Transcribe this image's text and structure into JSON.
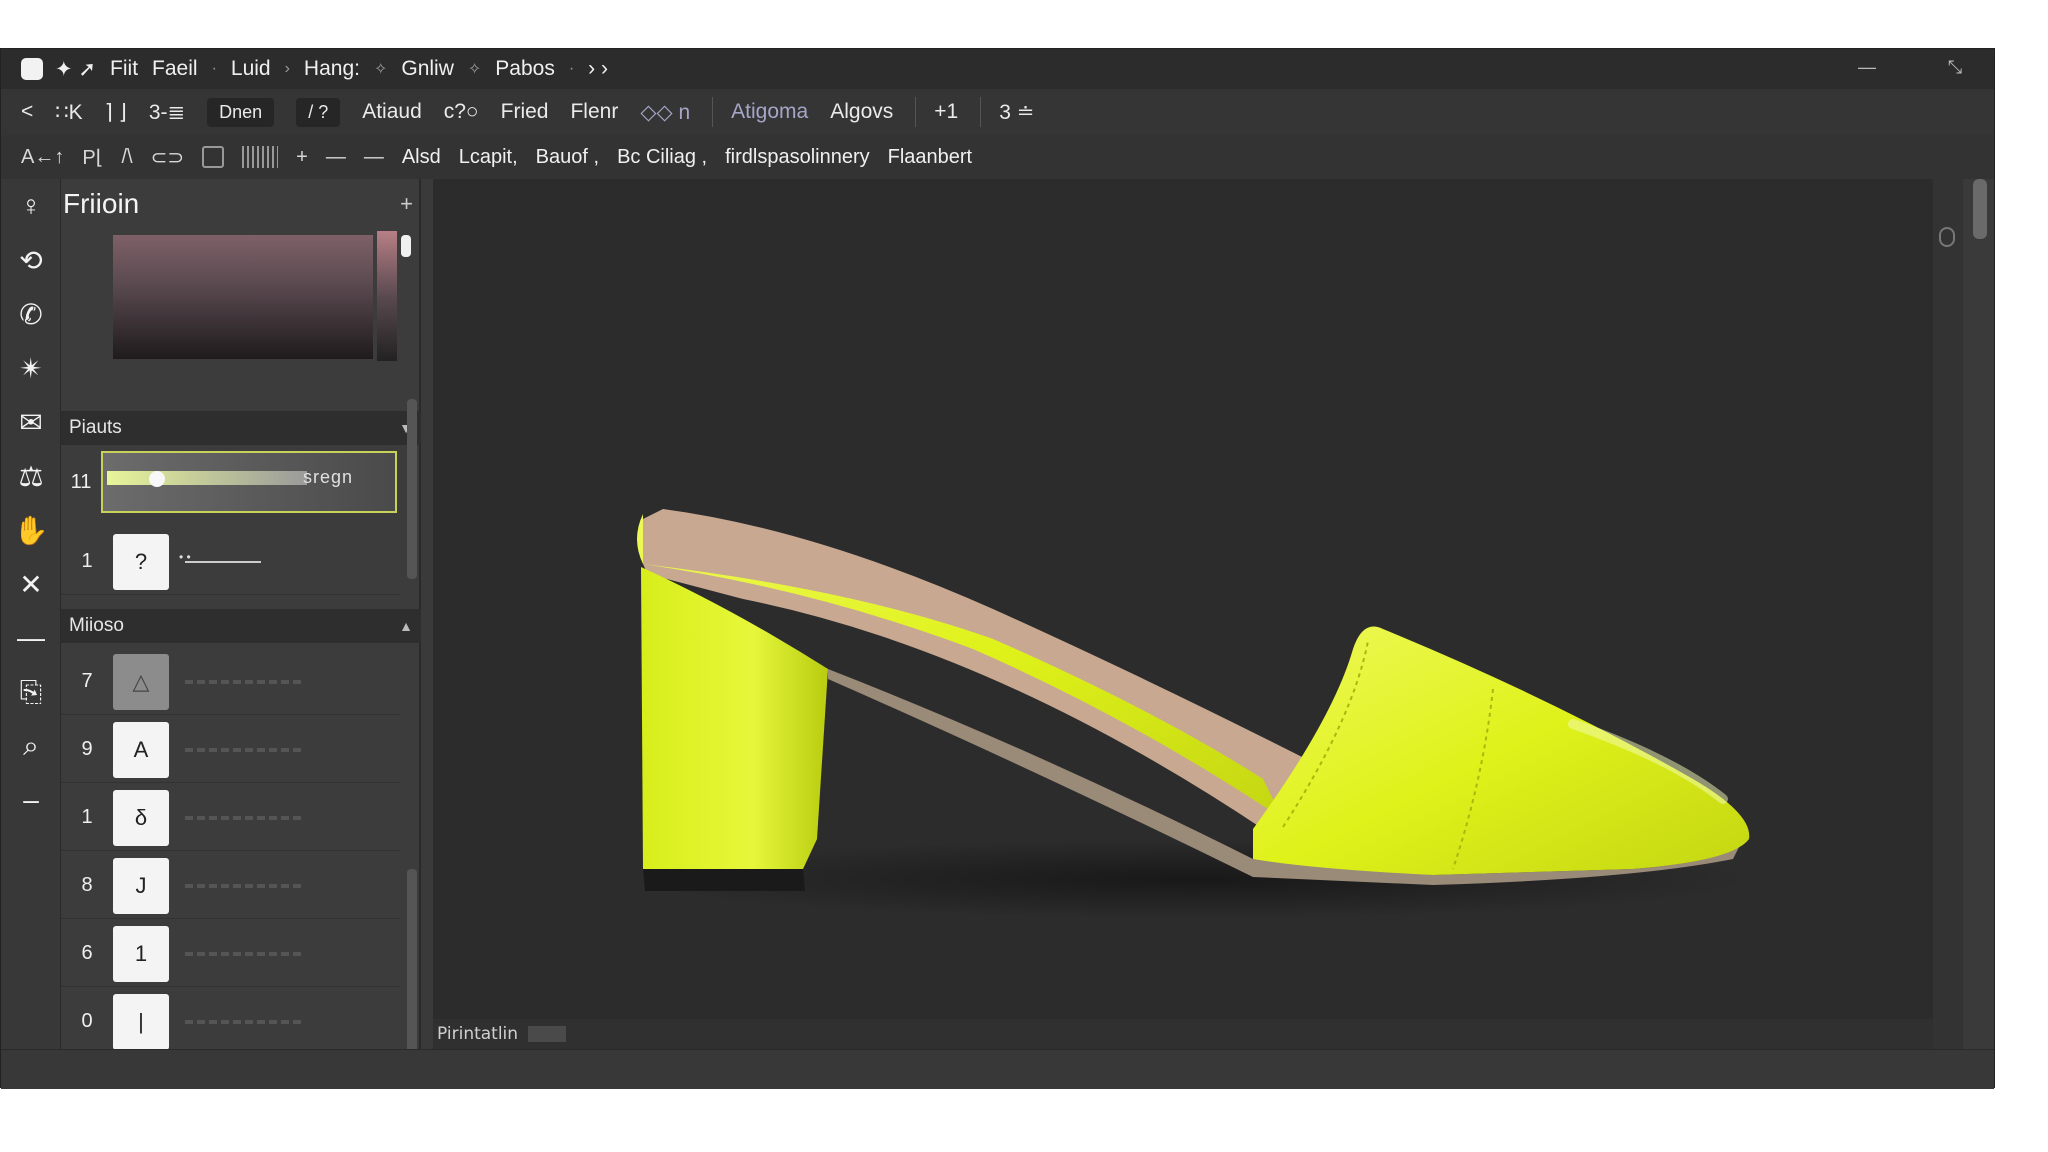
{
  "menubar": {
    "items": [
      "Fiit",
      "Faeil",
      "Luid",
      "Hang:",
      "Gnliw",
      "Pabos"
    ],
    "minimize_glyph": "—",
    "close_glyph": "⤡"
  },
  "toolbar": {
    "back": "<",
    "items": [
      "∷K",
      "⌉ ⌋",
      "3-≣",
      "Dnen",
      "/ ?",
      "Atiaud",
      "c?○",
      "Fried",
      "Flenr",
      "◇◇ n",
      "Atigoma",
      "Algovs",
      "+1",
      "3 ≐"
    ]
  },
  "optbar": {
    "left_glyphs": [
      "A←↑",
      "P⌊",
      "/\\",
      "⊂⊃"
    ],
    "labels": [
      "Alsd",
      "Lcapit,",
      "Bauof ,",
      "Bc Ciliag ,",
      "firdlspasolinnery",
      "Flaanbert"
    ]
  },
  "toolstrip": {
    "icons": [
      "pin-icon",
      "lasso-icon",
      "whatsapp-icon",
      "star-wand-icon",
      "stamp-icon",
      "eyedropper-icon",
      "hand-icon",
      "crossed-tools-icon",
      "minus-icon",
      "clipboard-icon",
      "search-icon",
      "divider-icon"
    ],
    "glyphs": [
      "♀",
      "⟲",
      "✆",
      "✴",
      "✉",
      "⚖",
      "✋",
      "✕",
      "—",
      "⎘",
      "⌕",
      "–"
    ]
  },
  "panel": {
    "title": "Friioin",
    "add": "+",
    "section1": "Piauts",
    "slider": {
      "index": "11",
      "label": "sregn",
      "value": 0.15
    },
    "row2": {
      "index": "1",
      "thumb": "?"
    },
    "section2": "Miioso",
    "layers": [
      {
        "index": "7",
        "thumb": "△",
        "gray": true
      },
      {
        "index": "9",
        "thumb": "A",
        "gray": false
      },
      {
        "index": "1",
        "thumb": "δ",
        "gray": false
      },
      {
        "index": "8",
        "thumb": "J",
        "gray": false
      },
      {
        "index": "6",
        "thumb": "1",
        "gray": false
      },
      {
        "index": "0",
        "thumb": "|",
        "gray": false
      }
    ]
  },
  "canvas": {
    "footer_label": "Pirintatlin",
    "shoe_color": "#dff21a",
    "insole_color": "#c8a890"
  },
  "colors": {
    "accent": "#c8d25a",
    "background": "#2c2c2c"
  }
}
